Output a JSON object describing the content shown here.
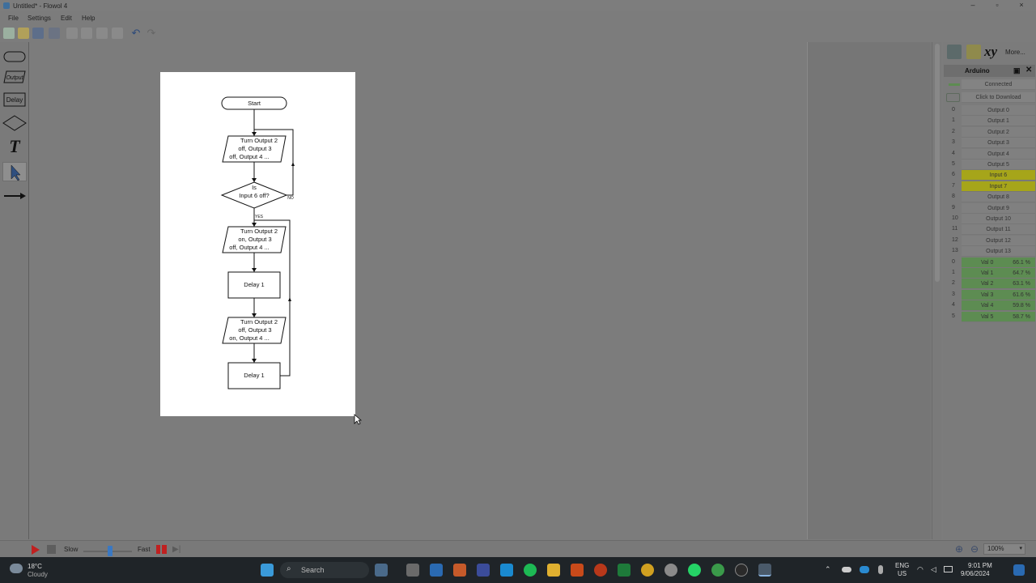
{
  "window": {
    "title": "Untitled* - Flowol 4",
    "minimize": "–",
    "maximize": "▫",
    "close": "×"
  },
  "menu": [
    "File",
    "Settings",
    "Edit",
    "Help"
  ],
  "toolbar_icons": [
    "new-icon",
    "open-icon",
    "save-icon",
    "print-icon",
    "cut-icon",
    "copy-icon",
    "paste-icon",
    "delete-icon",
    "undo-icon",
    "redo-icon"
  ],
  "tools": {
    "terminal": "",
    "output": "Output",
    "delay": "Delay",
    "decision": "",
    "text": "T",
    "select": "",
    "arrow": ""
  },
  "flowchart": {
    "start": "Start",
    "out1": [
      "Turn Output 2",
      "off, Output 3",
      "off, Output 4 ..."
    ],
    "decision": [
      "Is",
      "Input 6 off?"
    ],
    "no": "NO",
    "yes": "YES",
    "out2": [
      "Turn Output 2",
      "on, Output 3",
      "off, Output 4 ..."
    ],
    "delay1": "Delay 1",
    "out3": [
      "Turn Output 2",
      "off, Output 3",
      "on, Output 4 ..."
    ],
    "delay2": "Delay 1"
  },
  "panel": {
    "more": "More...",
    "xy": "xy",
    "title": "Arduino",
    "status": "Connected",
    "download": "Click to Download",
    "io": [
      {
        "n": "0",
        "label": "Output 0",
        "kind": "out"
      },
      {
        "n": "1",
        "label": "Output 1",
        "kind": "out"
      },
      {
        "n": "2",
        "label": "Output 2",
        "kind": "out"
      },
      {
        "n": "3",
        "label": "Output 3",
        "kind": "out"
      },
      {
        "n": "4",
        "label": "Output 4",
        "kind": "out"
      },
      {
        "n": "5",
        "label": "Output 5",
        "kind": "out"
      },
      {
        "n": "6",
        "label": "Input 6",
        "kind": "in"
      },
      {
        "n": "7",
        "label": "Input 7",
        "kind": "in"
      },
      {
        "n": "8",
        "label": "Output 8",
        "kind": "out"
      },
      {
        "n": "9",
        "label": "Output 9",
        "kind": "out"
      },
      {
        "n": "10",
        "label": "Output 10",
        "kind": "out"
      },
      {
        "n": "11",
        "label": "Output 11",
        "kind": "out"
      },
      {
        "n": "12",
        "label": "Output 12",
        "kind": "out"
      },
      {
        "n": "13",
        "label": "Output 13",
        "kind": "out"
      }
    ],
    "vals": [
      {
        "n": "0",
        "label": "Val 0",
        "pct": "66.1 %"
      },
      {
        "n": "1",
        "label": "Val 1",
        "pct": "64.7 %"
      },
      {
        "n": "2",
        "label": "Val 2",
        "pct": "63.1 %"
      },
      {
        "n": "3",
        "label": "Val 3",
        "pct": "61.6 %"
      },
      {
        "n": "4",
        "label": "Val 4",
        "pct": "59.8 %"
      },
      {
        "n": "5",
        "label": "Val 5",
        "pct": "58.7 %"
      }
    ]
  },
  "run": {
    "slow": "Slow",
    "fast": "Fast",
    "speed": 0.55,
    "zoom": "100%"
  },
  "taskbar": {
    "weather_temp": "18°C",
    "weather_desc": "Cloudy",
    "search": "Search",
    "lang1": "ENG",
    "lang2": "US",
    "time": "9:01 PM",
    "date": "9/06/2024"
  },
  "colors": {
    "accent": "#3a78c2",
    "input_on": "#a6a51a",
    "val_green": "#5d8c52",
    "run_red": "#c02020"
  }
}
